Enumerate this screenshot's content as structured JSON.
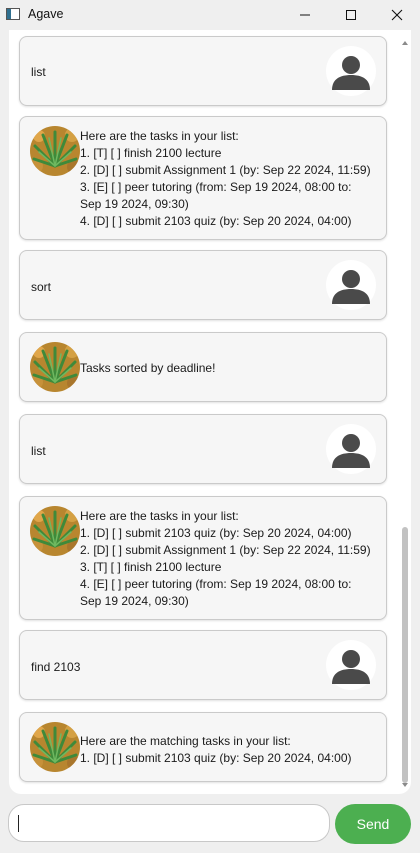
{
  "window": {
    "title": "Agave"
  },
  "messages": [
    {
      "type": "user",
      "text": "list"
    },
    {
      "type": "bot",
      "lines": [
        "Here are the tasks in your list:",
        "1.  [T] [ ]  finish 2100 lecture",
        "2.  [D] [ ]  submit Assignment 1 (by: Sep 22 2024, 11:59)",
        "3.  [E] [ ]  peer tutoring (from: Sep 19 2024, 08:00 to:",
        "Sep 19 2024, 09:30)",
        "4.  [D] [ ]  submit 2103 quiz (by: Sep 20 2024, 04:00)"
      ]
    },
    {
      "type": "user",
      "text": "sort"
    },
    {
      "type": "bot",
      "lines": [
        "Tasks sorted by deadline!"
      ]
    },
    {
      "type": "user",
      "text": "list"
    },
    {
      "type": "bot",
      "lines": [
        "Here are the tasks in your list:",
        "1.  [D] [ ]  submit 2103 quiz (by: Sep 20 2024, 04:00)",
        "2.  [D] [ ]  submit Assignment 1 (by: Sep 22 2024, 11:59)",
        "3.  [T] [ ]  finish 2100 lecture",
        "4.  [E] [ ]  peer tutoring (from: Sep 19 2024, 08:00 to:",
        "Sep 19 2024, 09:30)"
      ]
    },
    {
      "type": "user",
      "text": "find 2103"
    },
    {
      "type": "bot",
      "lines": [
        "Here are the matching tasks in your list:",
        "1.  [D] [ ]  submit 2103 quiz (by: Sep 20 2024, 04:00)"
      ]
    }
  ],
  "input": {
    "value": "",
    "placeholder": ""
  },
  "send_button": {
    "label": "Send"
  },
  "colors": {
    "accent": "#4caf50",
    "card_bg": "#f6f6f6",
    "card_border": "#cacaca",
    "window_bg": "#efefef"
  },
  "icons": {
    "app": "app-window-icon",
    "minimize": "minimize-icon",
    "maximize": "maximize-icon",
    "close": "close-icon",
    "user_avatar": "user-silhouette-icon",
    "bot_avatar": "agave-plant-icon"
  }
}
